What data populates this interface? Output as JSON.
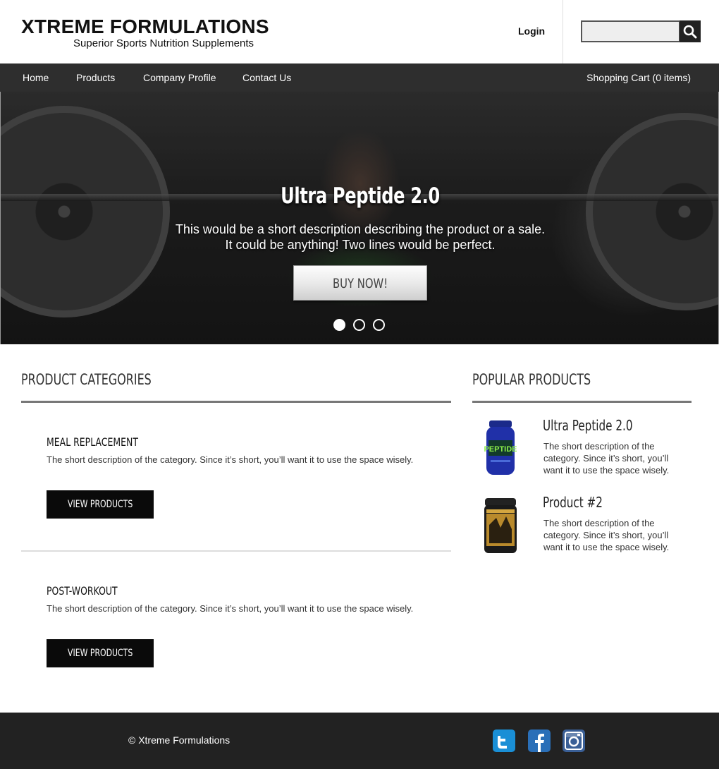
{
  "header": {
    "brand_name": "XTREME FORMULATIONS",
    "brand_tagline": "Superior Sports Nutrition Supplements",
    "login_label": "Login",
    "search": {
      "value": "",
      "placeholder": ""
    }
  },
  "nav": {
    "items": [
      {
        "label": "Home"
      },
      {
        "label": "Products"
      },
      {
        "label": "Company Profile"
      },
      {
        "label": "Contact Us"
      }
    ],
    "cart_label": "Shopping Cart (0 items)"
  },
  "hero": {
    "title": "Ultra Peptide 2.0",
    "desc_line1": "This would be a short description describing the product or a sale.",
    "desc_line2": "It could be anything! Two lines would be perfect.",
    "button_label": "BUY NOW!",
    "slides_total": 3,
    "active_slide": 1
  },
  "categories": {
    "heading": "PRODUCT CATEGORIES",
    "items": [
      {
        "title": "MEAL REPLACEMENT",
        "desc": "The short description of the category. Since it’s short, you’ll want it to use the space wisely.",
        "button": "VIEW PRODUCTS"
      },
      {
        "title": "POST-WORKOUT",
        "desc": "The short description of the category. Since it’s short, you’ll want it to use the space wisely.",
        "button": "VIEW PRODUCTS"
      }
    ]
  },
  "popular": {
    "heading": "POPULAR PRODUCTS",
    "items": [
      {
        "name": "Ultra Peptide 2.0",
        "desc": "The short description of the category. Since it’s short, you’ll want it to use the space wisely.",
        "image_icon": "blue-supplement-tub"
      },
      {
        "name": "Product #2",
        "desc": "The short description of the category. Since it’s short, you’ll want it to use the space wisely.",
        "image_icon": "black-gold-supplement-tub"
      }
    ]
  },
  "footer": {
    "copyright": "© Xtreme Formulations",
    "social": [
      {
        "icon": "twitter-icon",
        "color": "#1a8fd6"
      },
      {
        "icon": "facebook-icon",
        "color": "#2a6fb8"
      },
      {
        "icon": "instagram-icon",
        "color": "#3a5f96"
      }
    ]
  },
  "colors": {
    "nav_bg": "#2e2e2e",
    "footer_bg": "#222222",
    "button_dark": "#0a0a0a"
  }
}
